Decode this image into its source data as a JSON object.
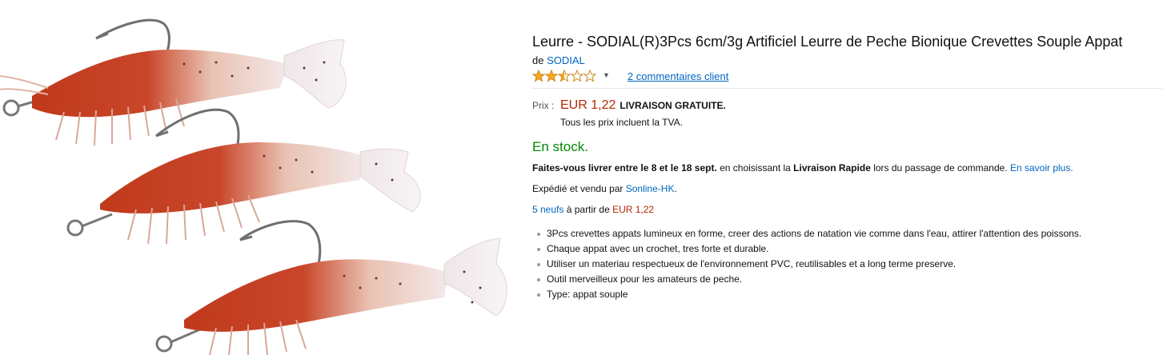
{
  "product": {
    "title": "Leurre - SODIAL(R)3Pcs 6cm/3g Artificiel Leurre de Peche Bionique Crevettes Souple Appat",
    "by_prefix": "de",
    "brand": "SODIAL",
    "rating": 2.5,
    "rating_max": 5,
    "reviews_label": "2 commentaires client",
    "image_alt_icon": "shrimp-lure-image",
    "price_label": "Prix :",
    "price": "EUR 1,22",
    "shipping": "LIVRAISON GRATUITE.",
    "vat_note": "Tous les prix incluent la TVA.",
    "stock": "En stock.",
    "delivery": {
      "bold_1": "Faites-vous livrer entre le 8 et le 18 sept.",
      "text_1": " en choisissant la ",
      "bold_2": "Livraison Rapide",
      "text_2": " lors du passage de commande. ",
      "link": "En savoir plus."
    },
    "shipped": {
      "prefix": "Expédié et vendu par ",
      "seller": "Sonline-HK",
      "suffix": "."
    },
    "offers": {
      "count_link": "5 neufs",
      "middle": " à partir de ",
      "price": "EUR 1,22"
    },
    "bullets": [
      "3Pcs crevettes appats lumineux en forme, creer des actions de natation vie comme dans l'eau, attirer l'attention des poissons.",
      "Chaque appat avec un crochet, tres forte et durable.",
      "Utiliser un materiau respectueux de l'environnement PVC, reutilisables et a long terme preserve.",
      "Outil merveilleux pour les amateurs de peche.",
      "Type: appat souple"
    ],
    "colors": {
      "link": "#0066c0",
      "price": "#b12704",
      "stock": "#008a00",
      "star": "#ffa41c"
    }
  }
}
